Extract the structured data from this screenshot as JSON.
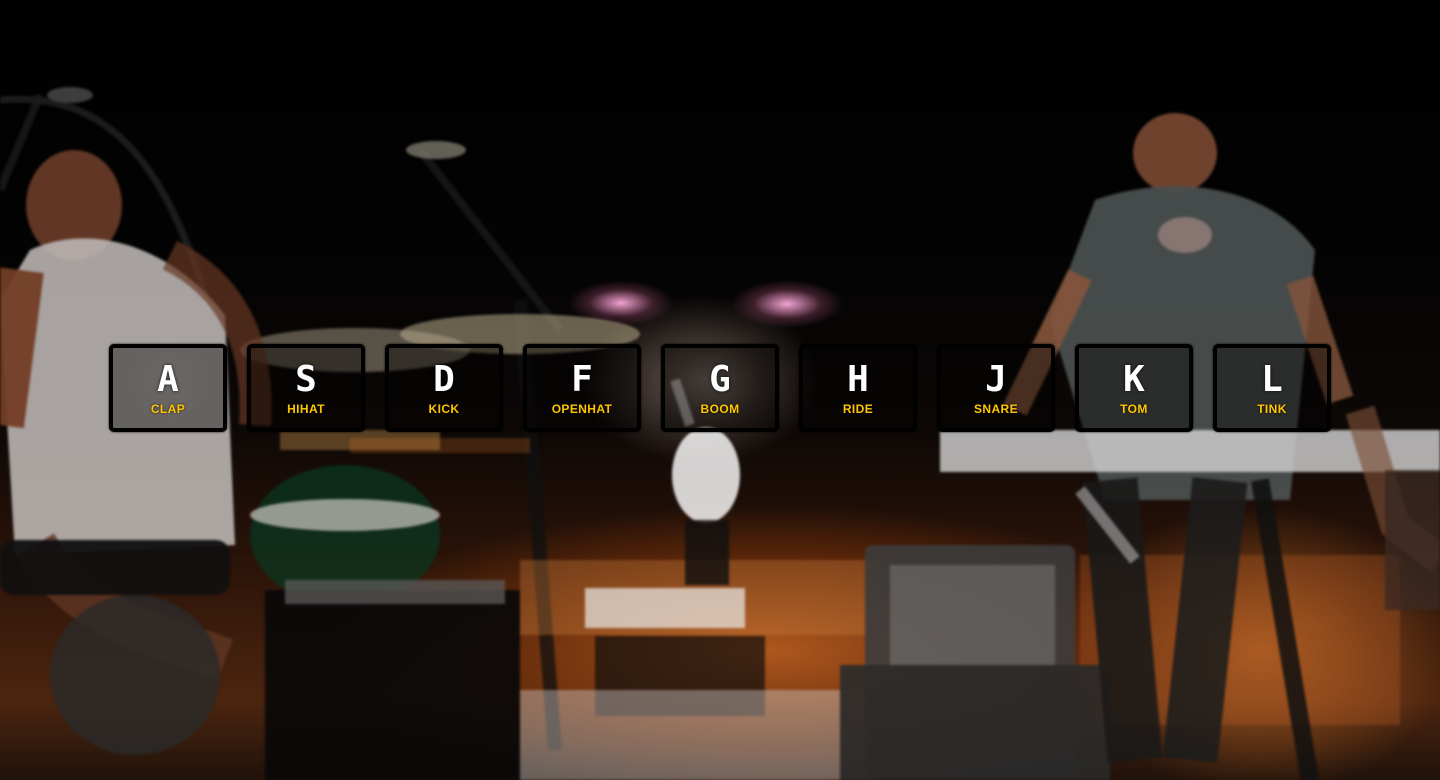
{
  "keys": [
    {
      "letter": "A",
      "sound": "clap"
    },
    {
      "letter": "S",
      "sound": "hihat"
    },
    {
      "letter": "D",
      "sound": "kick"
    },
    {
      "letter": "F",
      "sound": "openhat"
    },
    {
      "letter": "G",
      "sound": "boom"
    },
    {
      "letter": "H",
      "sound": "ride"
    },
    {
      "letter": "J",
      "sound": "snare"
    },
    {
      "letter": "K",
      "sound": "tom"
    },
    {
      "letter": "L",
      "sound": "tink"
    }
  ],
  "colors": {
    "accent": "#ffc600",
    "key_border": "#000000",
    "key_background": "rgba(0,0,0,0.4)"
  }
}
